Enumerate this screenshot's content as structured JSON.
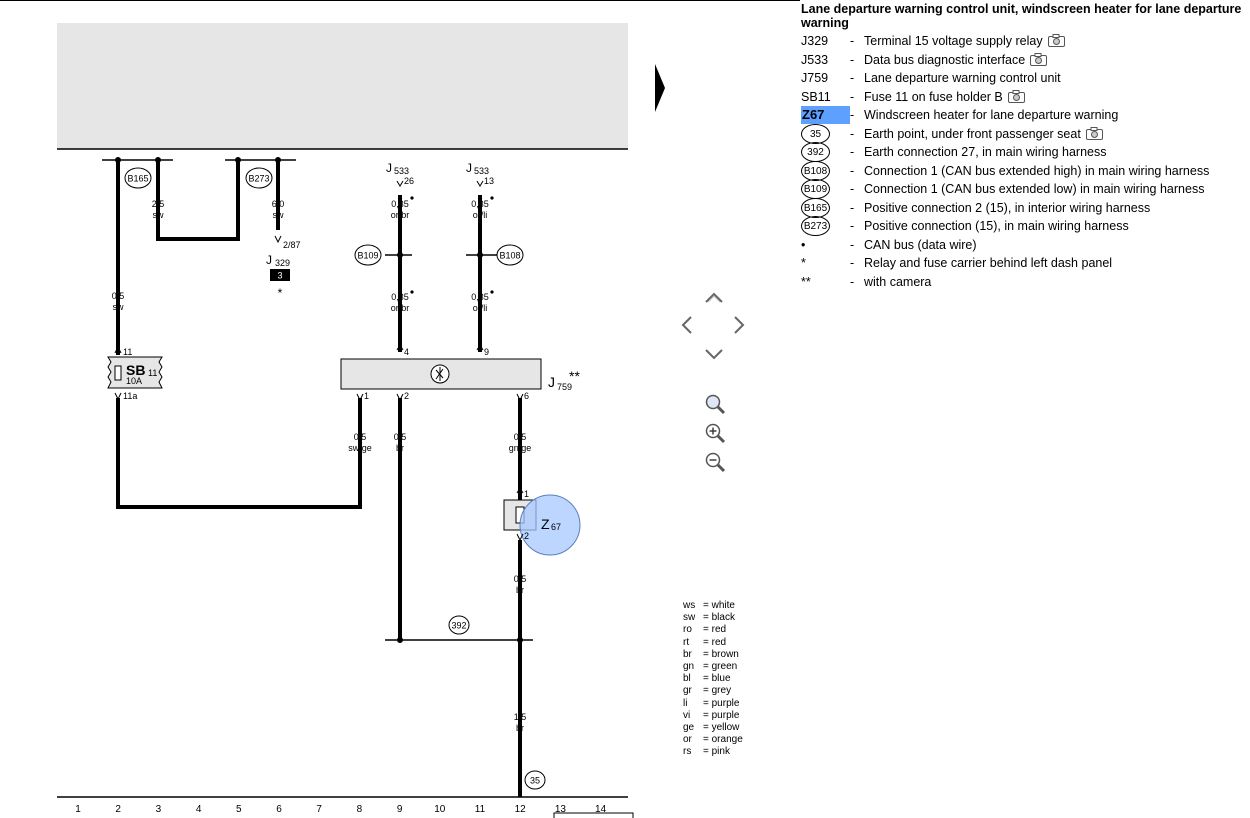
{
  "legend": {
    "title": "Lane departure warning control unit, windscreen heater for lane departure warning",
    "items": [
      {
        "code": "J329",
        "desc": "Terminal 15 voltage supply relay",
        "camera": true,
        "style": "text"
      },
      {
        "code": "J533",
        "desc": "Data bus diagnostic interface",
        "camera": true,
        "style": "text"
      },
      {
        "code": "J759",
        "desc": "Lane departure warning control unit",
        "camera": false,
        "style": "text"
      },
      {
        "code": "SB11",
        "desc": "Fuse 11 on fuse holder B",
        "camera": true,
        "style": "text"
      },
      {
        "code": "Z67",
        "desc": "Windscreen heater for lane departure warning",
        "camera": false,
        "style": "highlight"
      },
      {
        "code": "35",
        "desc": "Earth point, under front passenger seat",
        "camera": true,
        "style": "circle"
      },
      {
        "code": "392",
        "desc": "Earth connection 27, in main wiring harness",
        "camera": false,
        "style": "circle"
      },
      {
        "code": "B108",
        "desc": "Connection 1 (CAN bus extended high) in main wiring harness",
        "camera": false,
        "style": "circle"
      },
      {
        "code": "B109",
        "desc": "Connection 1 (CAN bus extended low) in main wiring harness",
        "camera": false,
        "style": "circle"
      },
      {
        "code": "B165",
        "desc": "Positive connection 2 (15), in interior wiring harness",
        "camera": false,
        "style": "circle"
      },
      {
        "code": "B273",
        "desc": "Positive connection (15), in main wiring harness",
        "camera": false,
        "style": "circle"
      },
      {
        "code": "•",
        "desc": "CAN bus (data wire)",
        "camera": false,
        "style": "text"
      },
      {
        "code": "*",
        "desc": "Relay and fuse carrier behind left dash panel",
        "camera": false,
        "style": "text"
      },
      {
        "code": "**",
        "desc": "with camera",
        "camera": false,
        "style": "text"
      }
    ]
  },
  "colors": [
    {
      "abbr": "ws",
      "name": "= white"
    },
    {
      "abbr": "sw",
      "name": "= black"
    },
    {
      "abbr": "ro",
      "name": "= red"
    },
    {
      "abbr": "rt",
      "name": "= red"
    },
    {
      "abbr": "br",
      "name": "= brown"
    },
    {
      "abbr": "gn",
      "name": "= green"
    },
    {
      "abbr": "bl",
      "name": "= blue"
    },
    {
      "abbr": "gr",
      "name": "= grey"
    },
    {
      "abbr": "li",
      "name": "= purple"
    },
    {
      "abbr": "vi",
      "name": "= purple"
    },
    {
      "abbr": "ge",
      "name": "= yellow"
    },
    {
      "abbr": "or",
      "name": "= orange"
    },
    {
      "abbr": "rs",
      "name": "= pink"
    }
  ],
  "diagram": {
    "grid_numbers": [
      "1",
      "2",
      "3",
      "4",
      "5",
      "6",
      "7",
      "8",
      "9",
      "10",
      "11",
      "12",
      "13",
      "14"
    ],
    "connectors": {
      "b165": "B165",
      "b273": "B273",
      "b109": "B109",
      "b108": "B108",
      "e392": "392",
      "e35": "35"
    },
    "components": {
      "j533_a": "J",
      "j533_a_sub": "533",
      "j533_b": "J",
      "j533_b_sub": "533",
      "j329": "J",
      "j329_sub": "329",
      "j329_pin": "2/87",
      "j329_box": "3",
      "j329_star": "*",
      "j759": "J",
      "j759_sub": "759",
      "j759_stars": "**",
      "sb11": "SB",
      "sb11_sub": "11",
      "sb11_rating": "10A",
      "z67": "Z",
      "z67_sub": "67"
    },
    "wires": {
      "w2_size": "0,5",
      "w2_color": "sw",
      "w3_size": "2,5",
      "w3_color": "sw",
      "w6_size": "6,0",
      "w6_color": "sw",
      "w9a_size": "0,35",
      "w9a_color": "or/br",
      "w9b_size": "0,35",
      "w9b_color": "or/br",
      "w11a_size": "0,35",
      "w11a_color": "or/li",
      "w11b_size": "0,35",
      "w11b_color": "or/li",
      "w8_size": "0,5",
      "w8_color": "sw/ge",
      "w9c_size": "0,5",
      "w9c_color": "br",
      "w12a_size": "0,5",
      "w12a_color": "gn/ge",
      "w12b_size": "0,5",
      "w12b_color": "br",
      "w12c_size": "1,5",
      "w12c_color": "br"
    },
    "pins": {
      "p26": "26",
      "p13": "13",
      "p11": "11",
      "p11a": "11a",
      "p4": "4",
      "p9": "9",
      "p1": "1",
      "p2": "2",
      "p6": "6",
      "z1": "1",
      "z2": "2"
    }
  },
  "nav": {
    "up": "chevron-up",
    "down": "chevron-down",
    "left": "chevron-left",
    "right": "chevron-right",
    "zoom_fit": "magnifier",
    "zoom_in": "magnifier-plus",
    "zoom_out": "magnifier-minus"
  }
}
